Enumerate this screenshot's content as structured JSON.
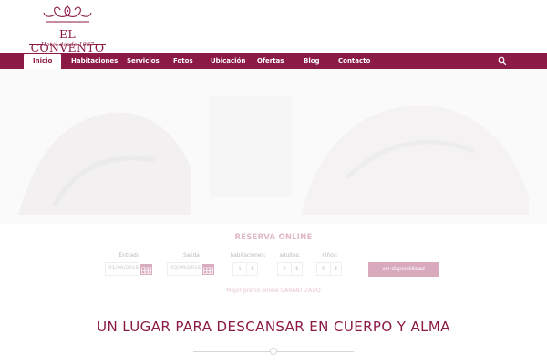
{
  "logo": {
    "title": "EL CONVENTO",
    "subtitle": "Hotel desde 1987"
  },
  "nav": {
    "items": [
      {
        "label": "Inicio",
        "active": true
      },
      {
        "label": "Habitaciones"
      },
      {
        "label": "Servicios"
      },
      {
        "label": "Fotos"
      },
      {
        "label": "Ubicación"
      },
      {
        "label": "Ofertas"
      },
      {
        "label": "Blog"
      },
      {
        "label": "Contacto"
      }
    ],
    "search_icon": "search-icon"
  },
  "booking": {
    "title": "RESERVA ONLINE",
    "checkin": {
      "label": "Entrada",
      "value": "01/09/2015"
    },
    "checkout": {
      "label": "Salida",
      "value": "02/09/2015"
    },
    "rooms": {
      "label": "habitaciones:",
      "value": "1"
    },
    "adults": {
      "label": "adultos:",
      "value": "2"
    },
    "children": {
      "label": "niños:",
      "value": "0"
    },
    "button_label": "ver disponibilidad",
    "guarantee": "Mejor precio online GARANTIZADO"
  },
  "tagline": "UN LUGAR PARA DESCANSAR EN CUERPO Y ALMA",
  "colors": {
    "brand": "#8b1a45",
    "button": "#d9a9bc"
  }
}
